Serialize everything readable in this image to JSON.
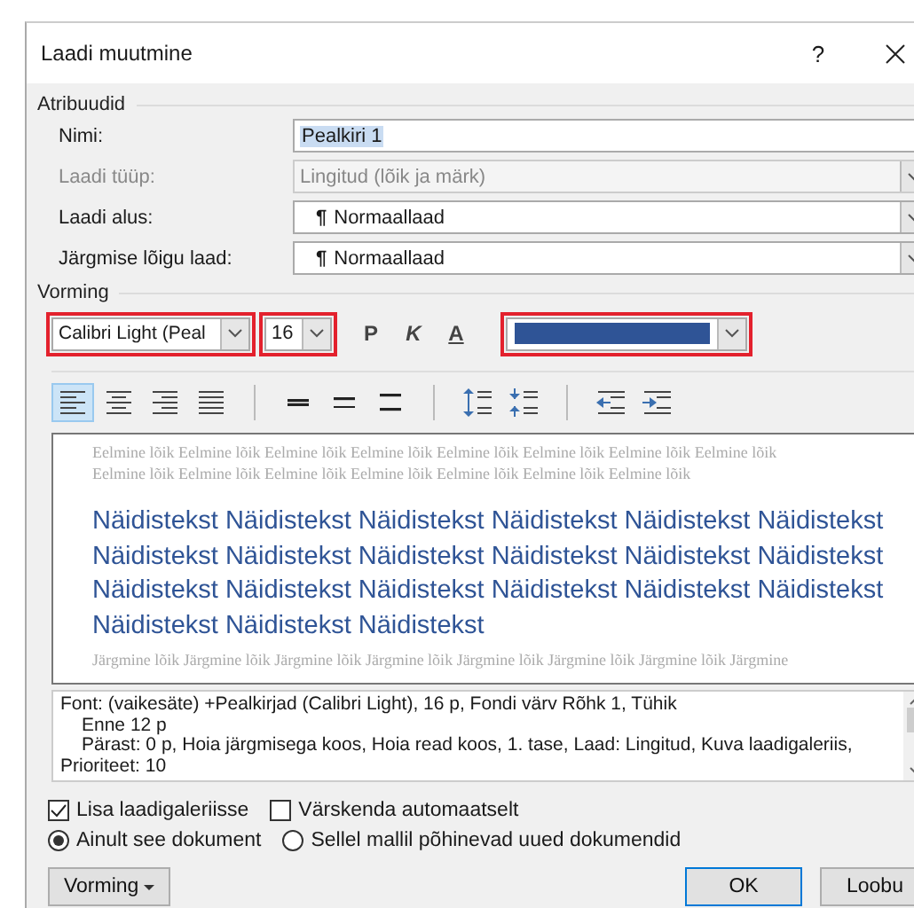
{
  "window": {
    "title": "Laadi muutmine",
    "help": "?"
  },
  "properties": {
    "heading": "Atribuudid",
    "fields": [
      {
        "label": "Nimi:",
        "value": "Pealkiri 1",
        "kind": "text",
        "disabled": false,
        "selected": true
      },
      {
        "label": "Laadi tüüp:",
        "value": "Lingitud (lõik ja märk)",
        "kind": "dropdown",
        "disabled": true,
        "selected": false
      },
      {
        "label": "Laadi alus:",
        "icon": "¶",
        "value": "Normaallaad",
        "kind": "dropdown",
        "disabled": false,
        "selected": false
      },
      {
        "label": "Järgmise lõigu laad:",
        "icon": "¶",
        "value": "Normaallaad",
        "kind": "dropdown",
        "disabled": false,
        "selected": false
      }
    ]
  },
  "formatting": {
    "heading": "Vorming",
    "font": "Calibri Light (Peal",
    "size": "16",
    "bold": "P",
    "italic": "K",
    "underline": "A",
    "color": "#2f5496",
    "tools": [
      {
        "kind": "align-left",
        "selected": true
      },
      {
        "kind": "align-center",
        "selected": false
      },
      {
        "kind": "align-right",
        "selected": false
      },
      {
        "kind": "justify",
        "selected": false
      },
      {
        "kind": "sep"
      },
      {
        "kind": "single",
        "selected": false
      },
      {
        "kind": "onehalf",
        "selected": false
      },
      {
        "kind": "double",
        "selected": false
      },
      {
        "kind": "sep"
      },
      {
        "kind": "space-more",
        "selected": false
      },
      {
        "kind": "space-less",
        "selected": false
      },
      {
        "kind": "sep"
      },
      {
        "kind": "outdent",
        "selected": false
      },
      {
        "kind": "indent",
        "selected": false
      }
    ]
  },
  "preview": {
    "previous": [
      "Eelmine lõik Eelmine lõik Eelmine lõik Eelmine lõik Eelmine lõik Eelmine lõik Eelmine lõik Eelmine lõik",
      "Eelmine lõik Eelmine lõik Eelmine lõik Eelmine lõik Eelmine lõik Eelmine lõik Eelmine lõik"
    ],
    "sample": [
      "Näidistekst Näidistekst Näidistekst Näidistekst Näidistekst Näidistekst",
      "Näidistekst Näidistekst Näidistekst Näidistekst Näidistekst Näidistekst",
      "Näidistekst Näidistekst Näidistekst Näidistekst Näidistekst Näidistekst",
      "Näidistekst Näidistekst Näidistekst"
    ],
    "next": [
      "Järgmine lõik Järgmine lõik Järgmine lõik Järgmine lõik Järgmine lõik Järgmine lõik Järgmine lõik Järgmine"
    ]
  },
  "description": [
    {
      "text": "Font: (vaikesäte) +Pealkirjad (Calibri Light), 16 p, Fondi värv Rõhk 1, Tühik",
      "indent": false
    },
    {
      "text": "Enne  12 p",
      "indent": true
    },
    {
      "text": "Pärast:  0 p, Hoia järgmisega koos, Hoia read koos, 1. tase, Laad: Lingitud, Kuva laadigaleriis,",
      "indent": true
    },
    {
      "text": "Prioriteet: 10",
      "indent": false
    }
  ],
  "checkboxes": [
    {
      "label": "Lisa laadigaleriisse",
      "checked": true
    },
    {
      "label": "Värskenda automaatselt",
      "checked": false
    }
  ],
  "radios": [
    {
      "label": "Ainult see dokument",
      "selected": true
    },
    {
      "label": "Sellel mallil põhinevad uued dokumendid",
      "selected": false
    }
  ],
  "buttons": {
    "format": "Vorming",
    "ok": "OK",
    "cancel": "Loobu"
  }
}
